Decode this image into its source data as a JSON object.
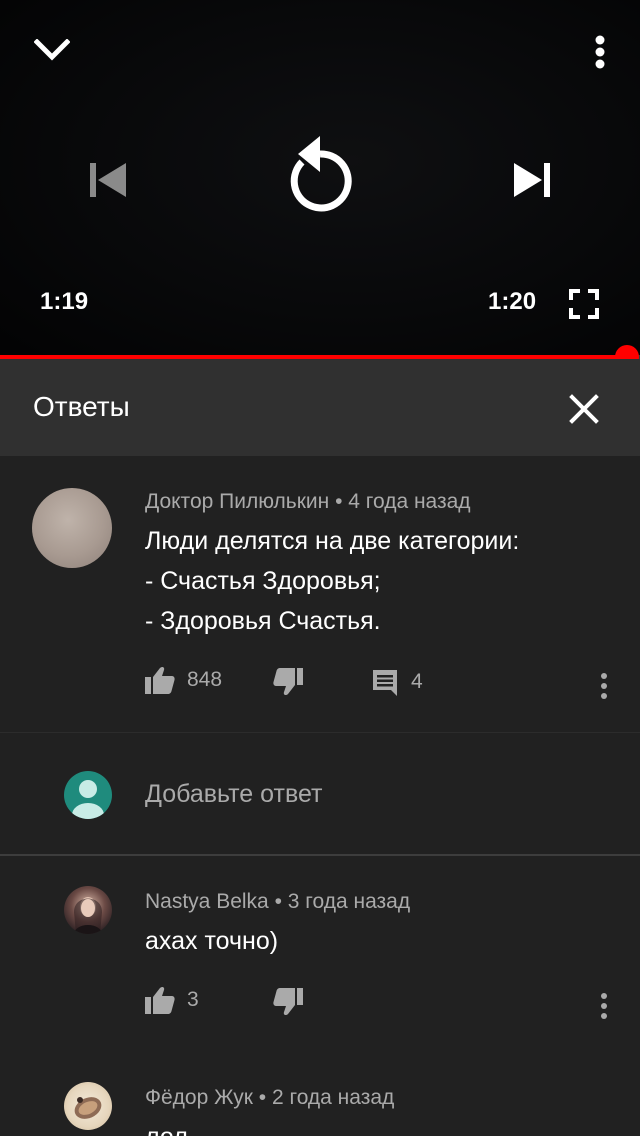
{
  "player": {
    "current_time": "1:19",
    "duration": "1:20",
    "progress": 0.98,
    "icons": [
      "chevron-down-icon",
      "more-vert-icon",
      "skip-previous-icon",
      "replay-icon",
      "skip-next-icon",
      "fullscreen-icon"
    ],
    "accent_color": "#ff0000"
  },
  "replies_panel": {
    "title": "Ответы",
    "close_icon": "close-icon"
  },
  "parent_comment": {
    "author": "Доктор Пилюлькин",
    "separator": "•",
    "time": "4 года назад",
    "lines": [
      "Люди делятся на две категории:",
      "- Счастья Здоровья;",
      "- Здоровья Счастья."
    ],
    "likes": "848",
    "replies_count": "4"
  },
  "add_reply": {
    "placeholder": "Добавьте ответ"
  },
  "replies": [
    {
      "author": "Nastya Belka",
      "separator": "•",
      "time": "3 года назад",
      "text": "ахах точно)",
      "likes": "3"
    },
    {
      "author": "Фёдор Жук",
      "separator": "•",
      "time": "2 года назад",
      "text": "лол"
    }
  ]
}
